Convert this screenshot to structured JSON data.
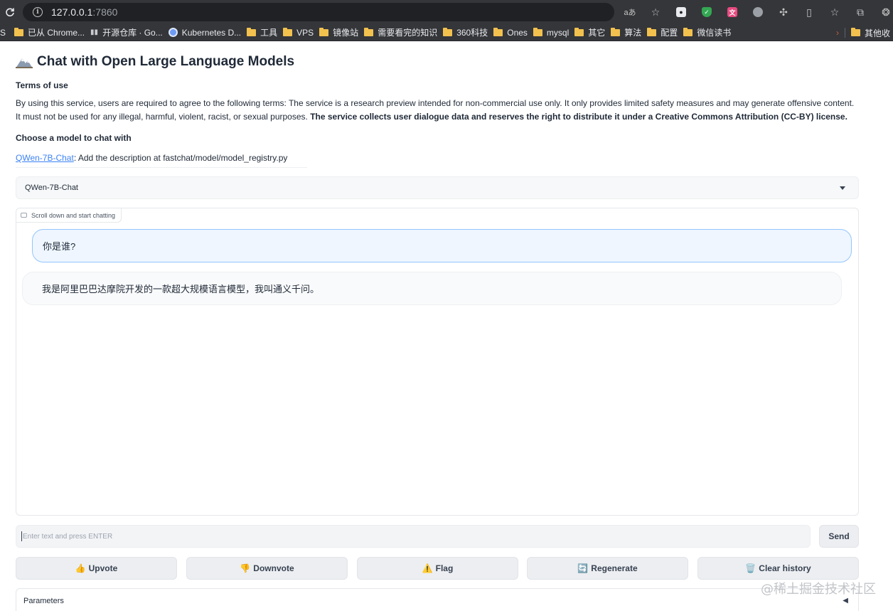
{
  "browser": {
    "url_host": "127.0.0.1",
    "url_port": ":7860",
    "toolbar_icons": [
      "translate-icon",
      "star-icon",
      "extension-icon",
      "shield-icon",
      "puzzle-icon",
      "sidepanel-icon",
      "favorites-icon",
      "collections-icon",
      "profile-icon"
    ],
    "bookmarks": [
      {
        "label": "S",
        "icon": "none"
      },
      {
        "label": "已从 Chrome...",
        "icon": "folder"
      },
      {
        "label": "开源仓库 · Go...",
        "icon": "book"
      },
      {
        "label": "Kubernetes D...",
        "icon": "globe"
      },
      {
        "label": "工具",
        "icon": "folder"
      },
      {
        "label": "VPS",
        "icon": "folder"
      },
      {
        "label": "镜像站",
        "icon": "folder"
      },
      {
        "label": "需要看完的知识",
        "icon": "folder"
      },
      {
        "label": "360科技",
        "icon": "folder"
      },
      {
        "label": "Ones",
        "icon": "folder"
      },
      {
        "label": "mysql",
        "icon": "folder"
      },
      {
        "label": "其它",
        "icon": "folder"
      },
      {
        "label": "算法",
        "icon": "folder"
      },
      {
        "label": "配置",
        "icon": "folder"
      },
      {
        "label": "微信读书",
        "icon": "folder"
      }
    ],
    "more_bookmarks": "其他收"
  },
  "app": {
    "title": "Chat with Open Large Language Models",
    "terms_heading": "Terms of use",
    "terms_text": "By using this service, users are required to agree to the following terms: The service is a research preview intended for non-commercial use only. It only provides limited safety measures and may generate offensive content. It must not be used for any illegal, harmful, violent, racist, or sexual purposes. ",
    "terms_bold": "The service collects user dialogue data and reserves the right to distribute it under a Creative Commons Attribution (CC-BY) license.",
    "choose_heading": "Choose a model to chat with",
    "model_link": "QWen-7B-Chat",
    "model_desc": ": Add the description at fastchat/model/model_registry.py",
    "selected_model": "QWen-7B-Chat"
  },
  "chat": {
    "label": "Scroll down and start chatting",
    "messages": [
      {
        "role": "user",
        "text": "你是谁?"
      },
      {
        "role": "assistant",
        "text": "我是阿里巴巴达摩院开发的一款超大规模语言模型，我叫通义千问。"
      }
    ]
  },
  "input": {
    "placeholder": "Enter text and press ENTER",
    "value": ""
  },
  "buttons": {
    "send": "Send",
    "upvote": "Upvote",
    "downvote": "Downvote",
    "flag": "Flag",
    "regenerate": "Regenerate",
    "clear": "Clear history",
    "upvote_emoji": "👍",
    "downvote_emoji": "👎",
    "flag_emoji": "⚠️",
    "regenerate_emoji": "🔄",
    "clear_emoji": "🗑️"
  },
  "params": {
    "label": "Parameters",
    "arrow": "◀"
  },
  "watermark": "@稀土掘金技术社区"
}
